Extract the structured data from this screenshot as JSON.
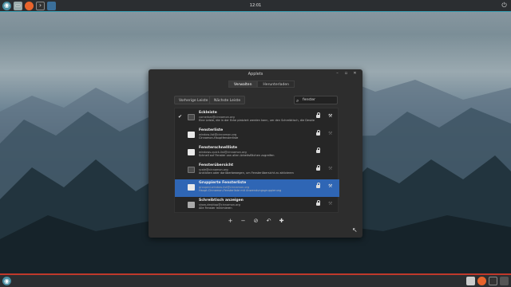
{
  "panel": {
    "clock": "12:01"
  },
  "window": {
    "title": "Applets",
    "tabs": [
      {
        "label": "Verwalten"
      },
      {
        "label": "Herunterladen"
      }
    ],
    "prev_label": "Vorherige Leiste",
    "next_label": "Nächste Leiste",
    "search_value": "fenster",
    "applets": [
      {
        "name": "Eckleiste",
        "uuid": "cornerbar@cinnamon.org",
        "desc": "Eine Leiste, die in der Ecke platziert werden kann, um den Schreibtisch, die Desklets, die Arbeitsflächenwahl oder die Fensterwahl anzeigen",
        "checked": true,
        "icon": "screen-icon",
        "configurable": true
      },
      {
        "name": "Fensterliste",
        "uuid": "window-list@cinnamon.org",
        "desc": "Cinnamon-Hauptfensterliste",
        "checked": false,
        "icon": "window-icon",
        "configurable": false
      },
      {
        "name": "Fensterschnellliste",
        "uuid": "windows-quick-list@cinnamon.org",
        "desc": "Schnell auf Fenster von allen Arbeitsflächen zugreifen",
        "checked": false,
        "icon": "window-icon",
        "configurable": false
      },
      {
        "name": "Fensterübersicht",
        "uuid": "scale@cinnamon.org",
        "desc": "Anklicken oder darüberbewegen, um Fensterübersicht zu aktivieren",
        "checked": false,
        "icon": "scale-icon",
        "configurable": false
      },
      {
        "name": "Gruppierte Fensterliste",
        "uuid": "grouped-window-list@cinnamon.org",
        "desc": "Haupt-Cinnamon-Fensterliste mit Anwendungsgruppierung",
        "checked": false,
        "icon": "window-icon",
        "configurable": true
      },
      {
        "name": "Schreibtisch anzeigen",
        "uuid": "show-desktop@cinnamon.org",
        "desc": "Alle Fenster minimieren",
        "checked": false,
        "icon": "desktop-icon",
        "configurable": false
      }
    ],
    "toolbar": [
      "+",
      "−",
      "⊘",
      "↶",
      "✚"
    ]
  }
}
